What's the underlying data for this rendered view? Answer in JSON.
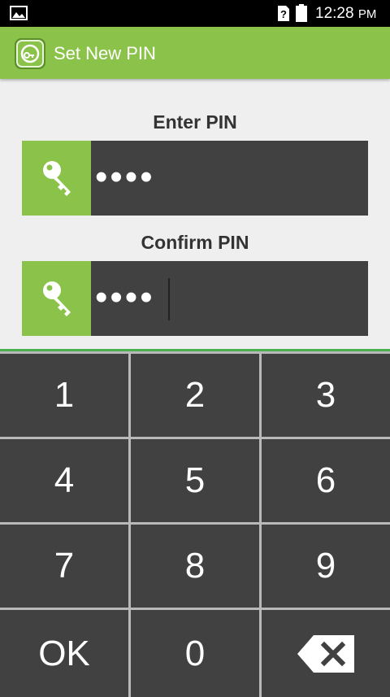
{
  "status_bar": {
    "time": "12:28",
    "ampm": "PM",
    "icons": [
      "image-icon",
      "sim-unknown-icon",
      "battery-icon"
    ]
  },
  "app_bar": {
    "title": "Set New PIN",
    "logo_icon": "lock-app-logo-icon"
  },
  "form": {
    "enter_label": "Enter PIN",
    "enter_value": "••••",
    "confirm_label": "Confirm PIN",
    "confirm_value": "••••",
    "field_icon": "key-icon"
  },
  "keypad": {
    "keys": [
      "1",
      "2",
      "3",
      "4",
      "5",
      "6",
      "7",
      "8",
      "9",
      "OK",
      "0"
    ],
    "backspace_icon": "backspace-icon"
  },
  "colors": {
    "accent": "#8bc34a",
    "field_bg": "#414141",
    "keypad_divider": "#4caf50",
    "background": "#efefef"
  }
}
